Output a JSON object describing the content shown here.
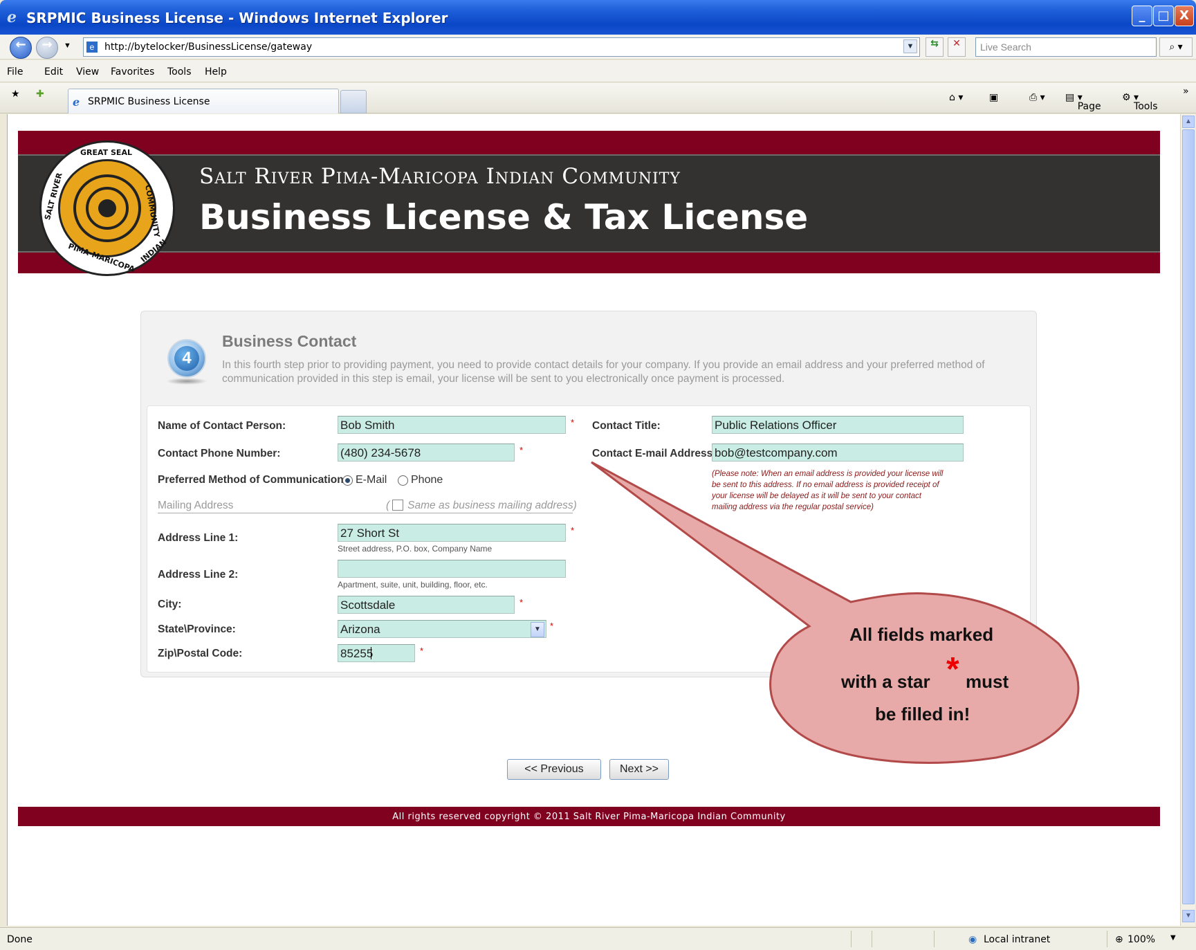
{
  "window": {
    "title": "SRPMIC Business License - Windows Internet Explorer",
    "minimize": "_",
    "maximize": "□",
    "close": "X"
  },
  "addressbar": {
    "url": "http://bytelocker/BusinessLicense/gateway",
    "search_placeholder": "Live Search"
  },
  "menu": [
    "File",
    "Edit",
    "View",
    "Favorites",
    "Tools",
    "Help"
  ],
  "tabbar": {
    "tab_label": "SRPMIC Business License",
    "cmd_page": "Page",
    "cmd_tools": "Tools"
  },
  "header": {
    "org_name": "Salt River Pima-Maricopa Indian Community",
    "site_title": "Business License & Tax License",
    "seal_text": [
      "GREAT SEAL",
      "SALT RIVER",
      "PIMA-MARICOPA",
      "INDIAN",
      "COMMUNITY"
    ]
  },
  "section": {
    "step_number": "4",
    "title": "Business Contact",
    "description": "In this fourth step prior to providing payment, you need to provide contact details for your company. If you provide an email address and your preferred method of communication provided in this step is email, your license will be sent to you electronically once payment is processed."
  },
  "form": {
    "contact_name_label": "Name of Contact Person:",
    "contact_name_value": "Bob Smith",
    "phone_label": "Contact Phone Number:",
    "phone_value": "(480) 234-5678",
    "pref_label": "Preferred Method of Communication:",
    "pref_options": [
      "E-Mail",
      "Phone"
    ],
    "pref_selected": "E-Mail",
    "contact_title_label": "Contact Title:",
    "contact_title_value": "Public Relations Officer",
    "email_label": "Contact E-mail Address:",
    "email_value": "bob@testcompany.com",
    "email_note": "(Please note: When an email address is provided your license will be sent to this address. If no email address is provided receipt of your license will be delayed as it will be sent to your contact mailing address via the regular postal service)",
    "mailing_header": "Mailing Address",
    "same_as_label": "Same as business mailing address)",
    "same_as_open": "(",
    "address1_label": "Address Line 1:",
    "address1_value": "27 Short St",
    "address1_hint": "Street address, P.O. box, Company Name",
    "address2_label": "Address Line 2:",
    "address2_value": "",
    "address2_hint": "Apartment, suite, unit, building, floor, etc.",
    "city_label": "City:",
    "city_value": "Scottsdale",
    "state_label": "State\\Province:",
    "state_value": "Arizona",
    "zip_label": "Zip\\Postal Code:",
    "zip_value": "85255",
    "required_mark": "*"
  },
  "buttons": {
    "previous": "<< Previous",
    "next": "Next >>"
  },
  "callout": {
    "line1": "All fields marked",
    "line2a": "with a star",
    "line2b": "must",
    "line3": "be filled in!",
    "star": "*"
  },
  "footer": {
    "copyright": "All rights reserved copyright © 2011 Salt River Pima-Maricopa Indian Community"
  },
  "statusbar": {
    "status": "Done",
    "zone": "Local intranet",
    "zoom": "100%"
  },
  "colors": {
    "banner": "#800020",
    "banner_dark": "#343131",
    "field_bg": "#c9ede4",
    "required": "#dd0000",
    "callout_fill": "#e8a9a9",
    "callout_stroke": "#b24a4a"
  }
}
